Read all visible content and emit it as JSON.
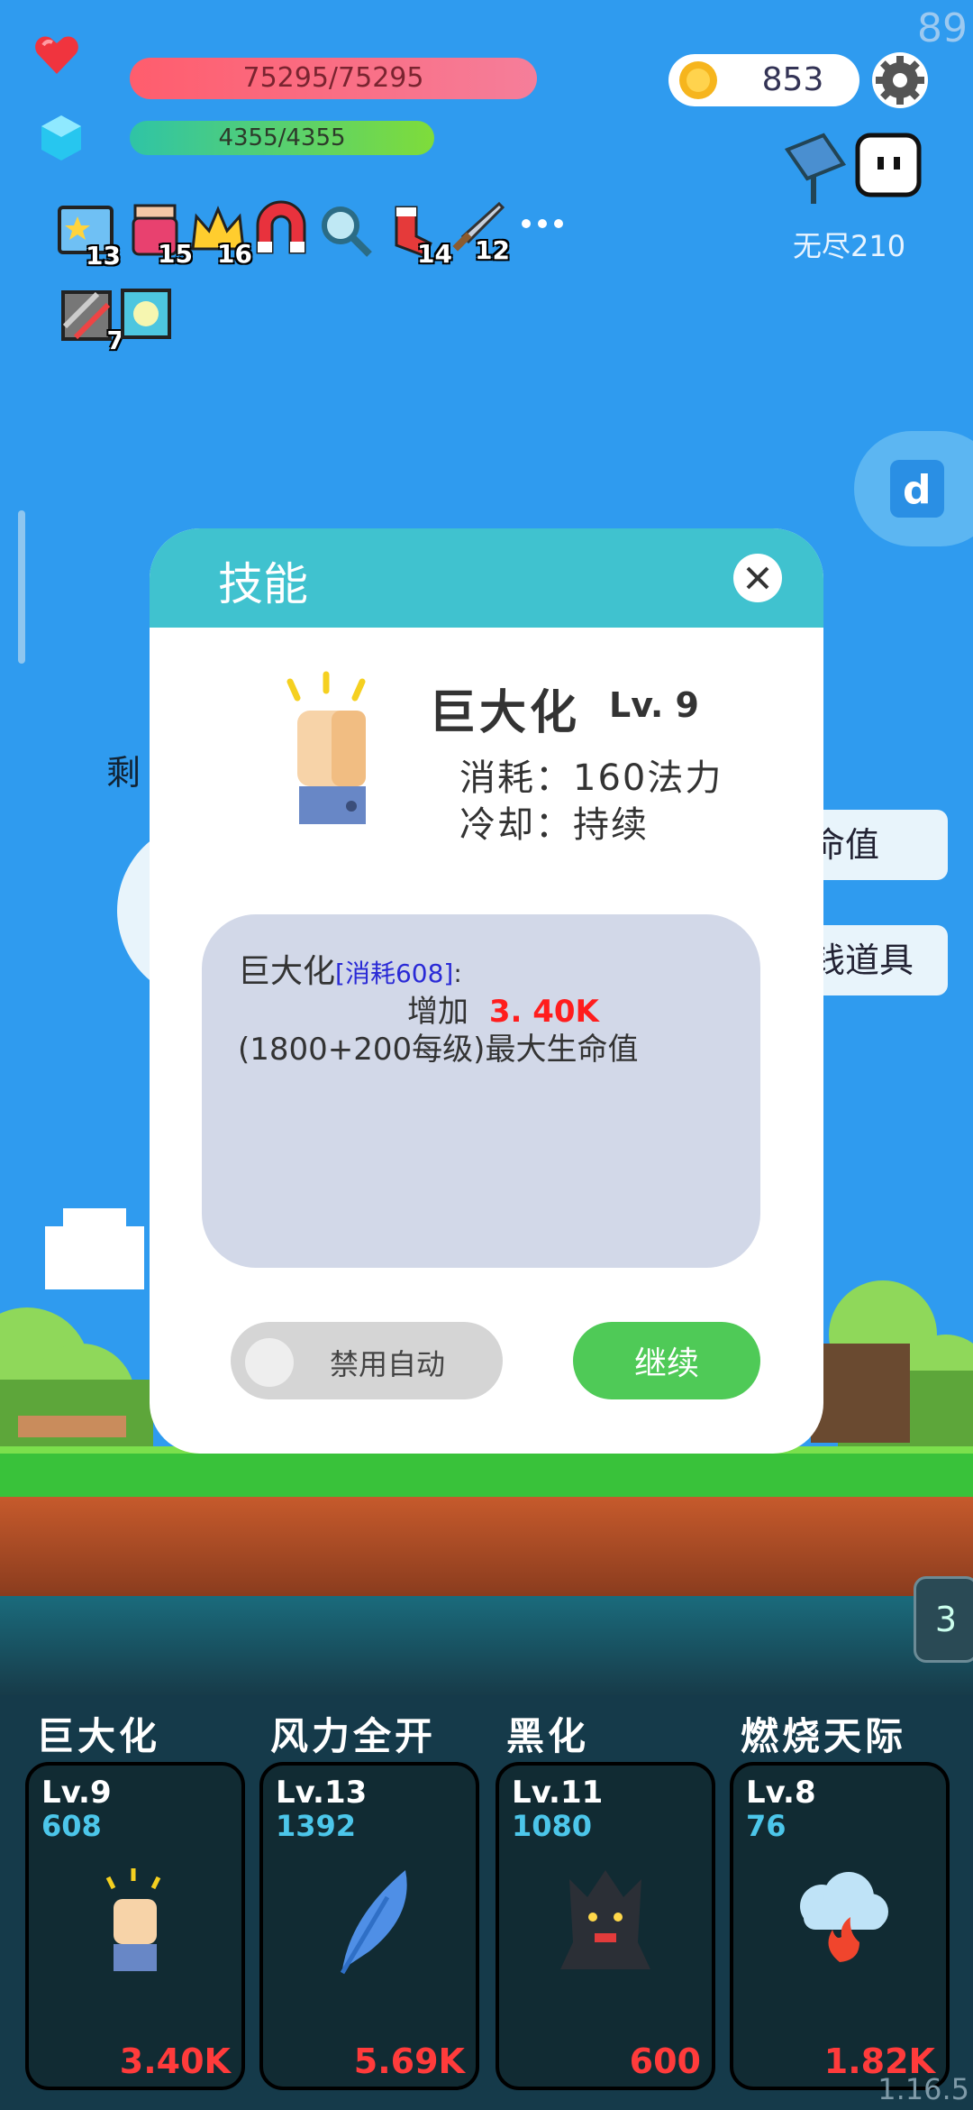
{
  "fps": "89",
  "hud": {
    "hp": "75295/75295",
    "mp": "4355/4355",
    "coins": "853",
    "mode_label": "无尽210"
  },
  "buffs": [
    {
      "icon": "star-card-icon",
      "count": "13"
    },
    {
      "icon": "jam-jar-icon",
      "count": "15"
    },
    {
      "icon": "crown-icon",
      "count": "16"
    },
    {
      "icon": "magnet-icon",
      "count": ""
    },
    {
      "icon": "magnifier-icon",
      "count": ""
    },
    {
      "icon": "sock-icon",
      "count": "14"
    },
    {
      "icon": "sword-icon",
      "count": "12"
    },
    {
      "icon": "more-icon",
      "count": ""
    },
    {
      "icon": "striped-card-icon",
      "count": "7"
    },
    {
      "icon": "gem-card-icon",
      "count": ""
    }
  ],
  "background": {
    "left_text": "剩",
    "btn1": "命值",
    "btn2": "钱道具",
    "wave": "3"
  },
  "dialog": {
    "title": "技能",
    "skill_name": "巨大化",
    "skill_level": "Lv. 9",
    "cost_line": "消耗：160法力",
    "cooldown_line": "冷却：持续",
    "desc_name": "巨大化",
    "desc_tag": "[消耗608]",
    "desc_colon": ":",
    "desc_prefix": "增加",
    "desc_value": "3. 40K",
    "desc_formula": "(1800+200每级)最大生命值",
    "toggle_label": "禁用自动",
    "toggle_on": false,
    "continue_label": "继续"
  },
  "skills": [
    {
      "name": "巨大化",
      "level": "Lv.9",
      "cost": "608",
      "value": "3.40K",
      "icon": "fist-icon"
    },
    {
      "name": "风力全开",
      "level": "Lv.13",
      "cost": "1392",
      "value": "5.69K",
      "icon": "feather-icon"
    },
    {
      "name": "黑化",
      "level": "Lv.11",
      "cost": "1080",
      "value": "600",
      "icon": "dark-tree-icon"
    },
    {
      "name": "燃烧天际",
      "level": "Lv.8",
      "cost": "76",
      "value": "1.82K",
      "icon": "fire-cloud-icon"
    }
  ],
  "version": "1.16.5",
  "colors": {
    "accent": "#40c2cf",
    "continue": "#4fca57",
    "danger": "#ff3b3b",
    "cost": "#4cc6ea"
  }
}
